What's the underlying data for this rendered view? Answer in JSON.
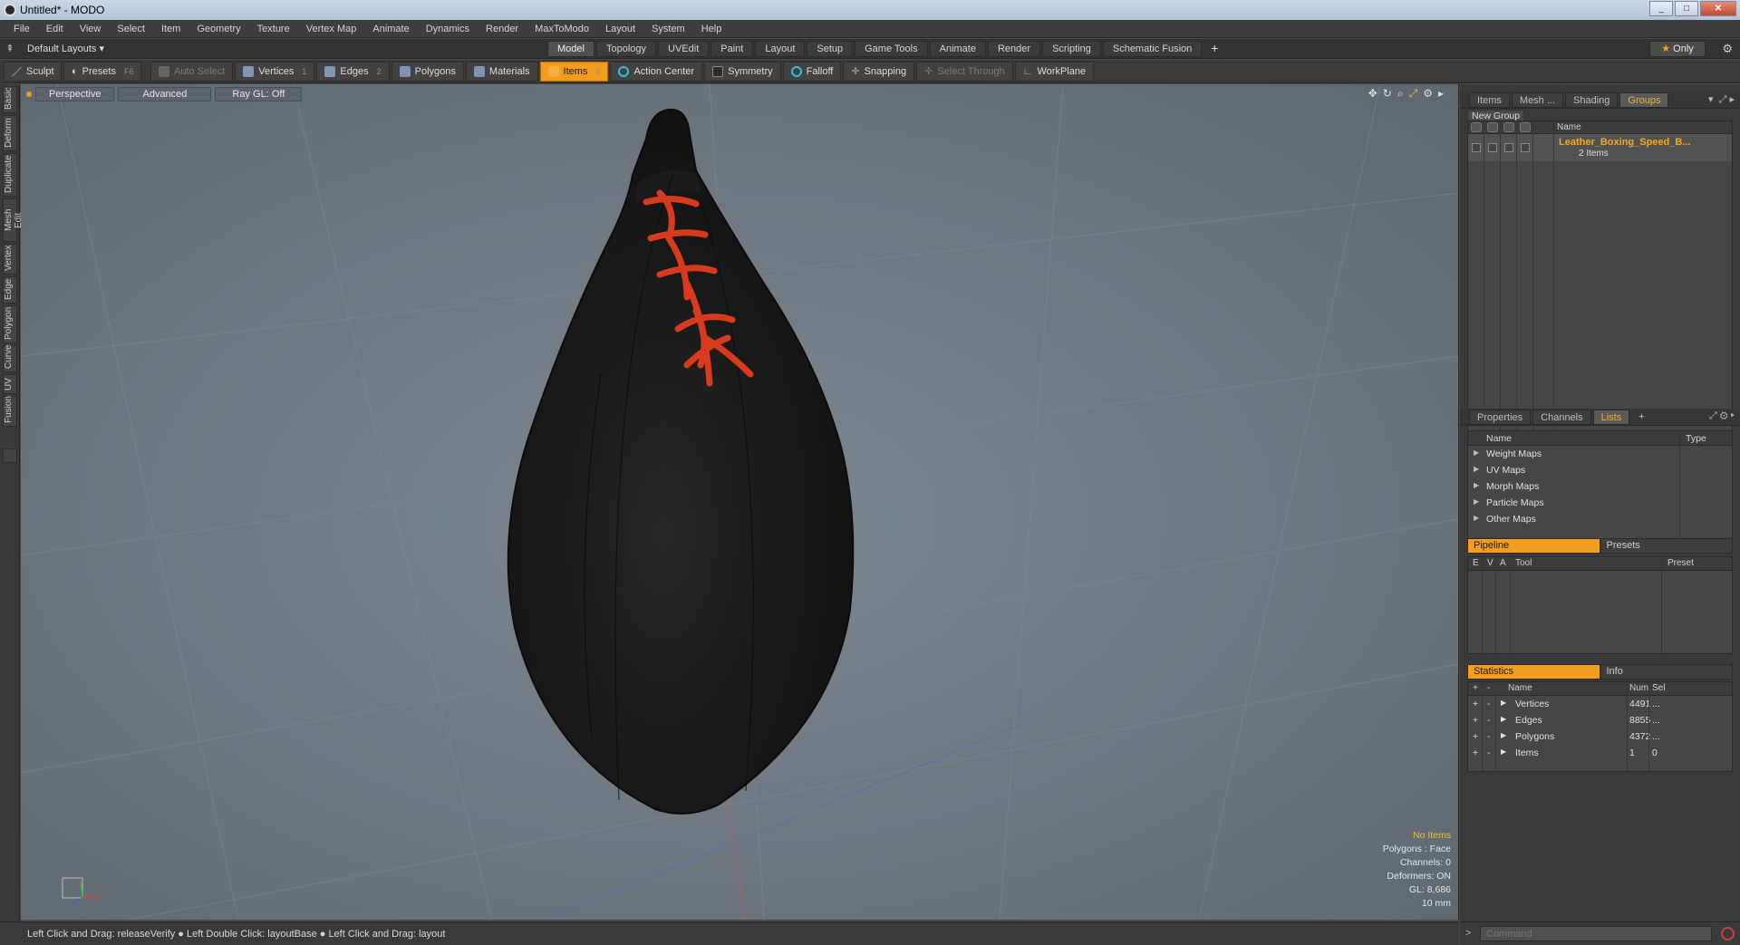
{
  "window": {
    "title": "Untitled* - MODO",
    "min": "_",
    "max": "□",
    "close": "✕"
  },
  "menu": [
    "File",
    "Edit",
    "View",
    "Select",
    "Item",
    "Geometry",
    "Texture",
    "Vertex Map",
    "Animate",
    "Dynamics",
    "Render",
    "MaxToModo",
    "Layout",
    "System",
    "Help"
  ],
  "layoutbar": {
    "layout_label": "Default Layouts ▾",
    "tabs": [
      "Model",
      "Topology",
      "UVEdit",
      "Paint",
      "Layout",
      "Setup",
      "Game Tools",
      "Animate",
      "Render",
      "Scripting",
      "Schematic Fusion"
    ],
    "active_tab": "Model",
    "add": "+",
    "only_label": "Only"
  },
  "toolbar": {
    "sculpt": "Sculpt",
    "presets": "Presets",
    "presets_key": "F6",
    "auto_select": "Auto Select",
    "vertices": "Vertices",
    "vertices_key": "1",
    "edges": "Edges",
    "edges_key": "2",
    "polygons": "Polygons",
    "materials": "Materials",
    "items": "Items",
    "items_key": "5",
    "action_center": "Action Center",
    "symmetry": "Symmetry",
    "falloff": "Falloff",
    "snapping": "Snapping",
    "select_through": "Select Through",
    "workplane": "WorkPlane"
  },
  "left_tabs": [
    "Basic",
    "Deform",
    "Duplicate",
    "Mesh Edit",
    "Vertex",
    "Edge",
    "Polygon",
    "Curve",
    "UV",
    "Fusion"
  ],
  "viewport": {
    "view": "Perspective",
    "advanced": "Advanced",
    "raygl": "Ray GL: Off",
    "info": {
      "no_items": "No Items",
      "polygons": "Polygons : Face",
      "channels": "Channels: 0",
      "deformers": "Deformers: ON",
      "gl": "GL: 8,686",
      "scale": "10 mm"
    }
  },
  "statusbar": {
    "text": "Left Click and Drag: releaseVerify ● Left Double Click: layoutBase ● Left Click and Drag: layout"
  },
  "right_panel": {
    "top_tabs": [
      "Items",
      "Mesh ...",
      "Shading",
      "Groups"
    ],
    "active_top_tab": "Groups",
    "new_group": "New Group",
    "groups_header_name": "Name",
    "group": {
      "name": "Leather_Boxing_Speed_B...",
      "count": "2 Items"
    },
    "mid_tabs": [
      "Properties",
      "Channels",
      "Lists"
    ],
    "active_mid_tab": "Lists",
    "lists_header": {
      "name": "Name",
      "type": "Type"
    },
    "lists": [
      "Weight Maps",
      "UV Maps",
      "Morph Maps",
      "Particle Maps",
      "Other Maps"
    ],
    "pipeline_tabs": [
      "Pipeline",
      "Presets"
    ],
    "pipeline_header": {
      "e": "E",
      "v": "V",
      "a": "A",
      "tool": "Tool",
      "preset": "Preset"
    },
    "stats_tabs": [
      "Statistics",
      "Info"
    ],
    "stats_header": {
      "plus": "+",
      "minus": "-",
      "name": "Name",
      "num": "Num",
      "sel": "Sel"
    },
    "stats": [
      {
        "name": "Vertices",
        "num": "4491",
        "sel": "..."
      },
      {
        "name": "Edges",
        "num": "8855",
        "sel": "..."
      },
      {
        "name": "Polygons",
        "num": "4372",
        "sel": "..."
      },
      {
        "name": "Items",
        "num": "1",
        "sel": "0"
      }
    ],
    "command_placeholder": "Command"
  },
  "colors": {
    "accent": "#f39d1e",
    "lace": "#d83a1e",
    "bag": "#1e1e1e"
  }
}
